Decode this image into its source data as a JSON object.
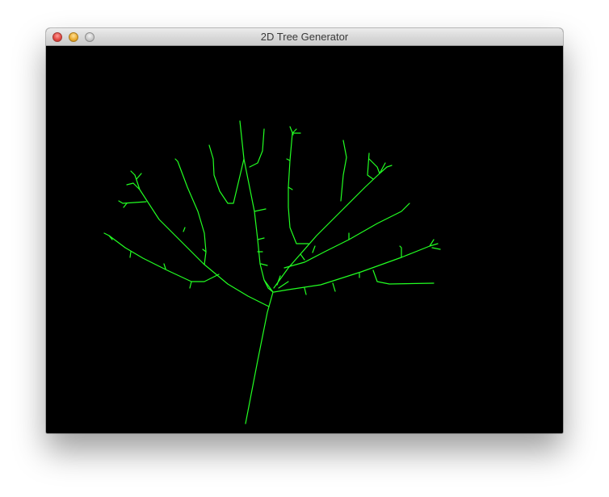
{
  "window": {
    "title": "2D Tree Generator",
    "controls": {
      "close_icon": "close-icon",
      "minimize_icon": "minimize-icon",
      "zoom_icon": "zoom-icon"
    }
  },
  "canvas": {
    "background": "#000000",
    "branch_color": "#22ff22"
  }
}
